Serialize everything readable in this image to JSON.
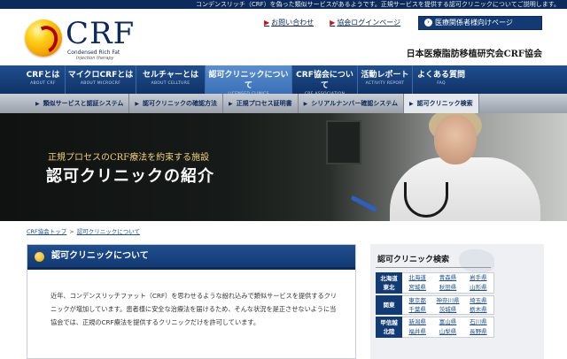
{
  "top_notice": "コンデンスリッチ（CRF）を偽った類似サービスがあるようです。正規サービスを提供する認可クリニックについてご説明します。",
  "logo": {
    "name": "CRF",
    "sub": "Condensed Rich Fat",
    "tagline": "Injection therapy"
  },
  "utility": {
    "links": [
      {
        "label": "お問い合わせ"
      },
      {
        "label": "協会ログインページ"
      }
    ],
    "medical_button": "医療関係者様向けページ",
    "org_name": "日本医療脂肪移植研究会CRF協会"
  },
  "main_nav": [
    {
      "jp": "CRFとは",
      "en": "ABOUT CRF",
      "active": false
    },
    {
      "jp": "マイクロCRFとは",
      "en": "ABOUT MICROCRF",
      "active": false
    },
    {
      "jp": "セルチャーとは",
      "en": "ABOUT CELLTURE",
      "active": false
    },
    {
      "jp": "認可クリニックについて",
      "en": "LICENSED CLINICS",
      "active": true
    },
    {
      "jp": "CRF協会について",
      "en": "CRF ASSOCIATION",
      "active": false
    },
    {
      "jp": "活動レポート",
      "en": "ACTIVITY REPORT",
      "active": false
    },
    {
      "jp": "よくある質問",
      "en": "FAQ",
      "active": false
    }
  ],
  "sub_nav": [
    {
      "label": "類似サービスと認証システム",
      "active": false
    },
    {
      "label": "認可クリニックの確認方法",
      "active": false
    },
    {
      "label": "正規プロセス証明書",
      "active": false
    },
    {
      "label": "シリアルナンバー確認システム",
      "active": false
    },
    {
      "label": "認可クリニック検索",
      "active": true
    }
  ],
  "hero": {
    "subtitle": "正規プロセスのCRF療法を約束する施設",
    "title": "認可クリニックの紹介"
  },
  "breadcrumb": {
    "home": "CRF協会トップ",
    "separator": ">",
    "current": "認可クリニックについて"
  },
  "main": {
    "heading": "認可クリニックについて",
    "body": "近年、コンデンスリッチファット（CRF）を思わせるような紛れ込みで類似サービスを提供するクリニックが増加しています。患者様に安全な治療法を届けるため、そんな状況を是正させないように当協会では、正規のCRF療法を提供するクリニックだけを許可しています。"
  },
  "side": {
    "title": "認可クリニック検索",
    "regions": [
      {
        "label": "北海道\n東北",
        "prefs": [
          "北海道",
          "青森県",
          "岩手県",
          "宮城県",
          "秋田県",
          "山形県"
        ],
        "off": [
          false,
          false,
          false,
          false,
          false,
          false
        ]
      },
      {
        "label": "関東",
        "prefs": [
          "東京都",
          "神奈川県",
          "埼玉県",
          "千葉県",
          "茨城県",
          "栃木県"
        ],
        "off": [
          false,
          false,
          false,
          false,
          false,
          false
        ]
      },
      {
        "label": "甲信越\n北陸",
        "prefs": [
          "新潟県",
          "富山県",
          "石川県",
          "福井県",
          "山梨県",
          "長野県"
        ],
        "off": [
          false,
          false,
          false,
          false,
          false,
          false
        ]
      }
    ]
  }
}
